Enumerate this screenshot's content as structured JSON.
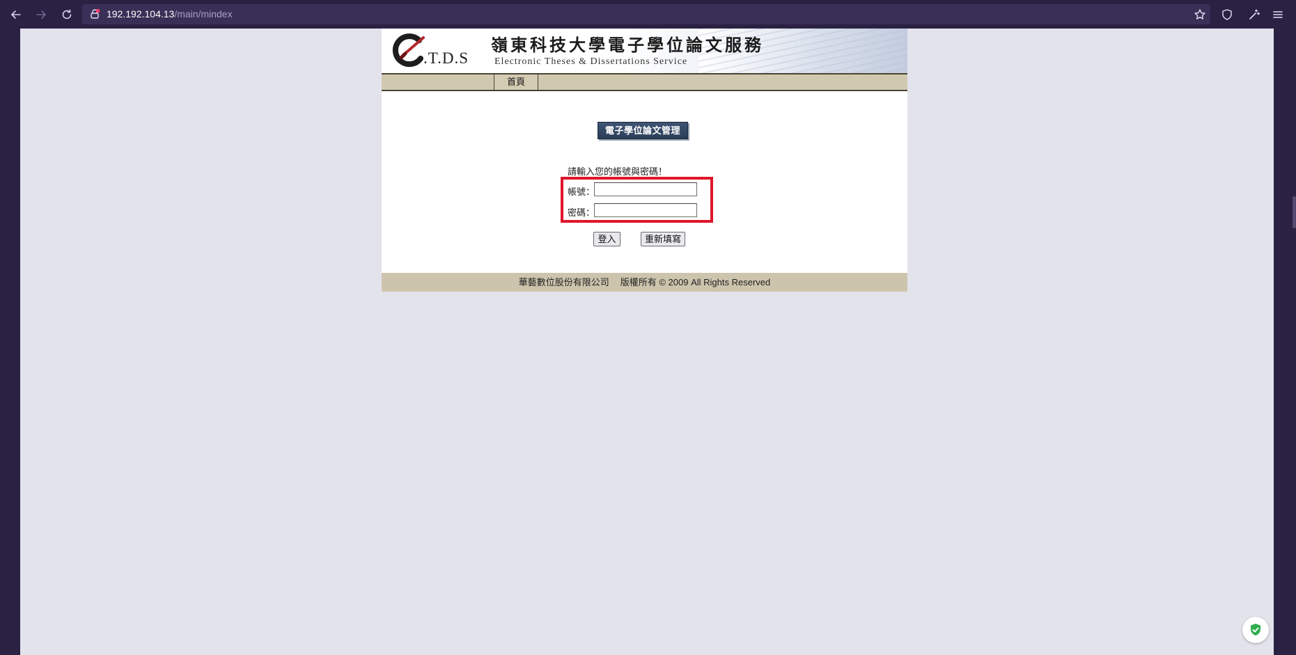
{
  "browser": {
    "url_host": "192.192.104.13",
    "url_path": "/main/mindex",
    "icons": {
      "back": "arrow-left-icon",
      "forward": "arrow-right-icon",
      "reload": "reload-icon",
      "lock": "lock-icon",
      "bookmark": "star-icon",
      "shield": "shield-icon",
      "extensions": "wand-icon",
      "menu": "hamburger-menu-icon"
    }
  },
  "header": {
    "logo_text": ".T.D.S",
    "title": "嶺東科技大學電子學位論文服務",
    "subtitle": "Electronic Theses & Dissertations Service"
  },
  "nav": {
    "items": [
      {
        "label": "首頁"
      }
    ]
  },
  "main": {
    "section_title": "電子學位論文管理",
    "prompt": "請輸入您的帳號與密碼！",
    "account_label": "帳號：",
    "account_value": "",
    "password_label": "密碼：",
    "password_value": "",
    "login_button": "登入",
    "reset_button": "重新填寫"
  },
  "footer": {
    "company": "華藝數位股份有限公司",
    "copyright": "版權所有 © 2009 All Rights Reserved"
  },
  "colors": {
    "browser_chrome": "#2b2143",
    "page_background": "#e3e3ec",
    "nav_bar": "#d1c8b0",
    "highlight": "#e0162b",
    "section_button": "#2b3d58",
    "badge_green": "#2fae4e"
  }
}
